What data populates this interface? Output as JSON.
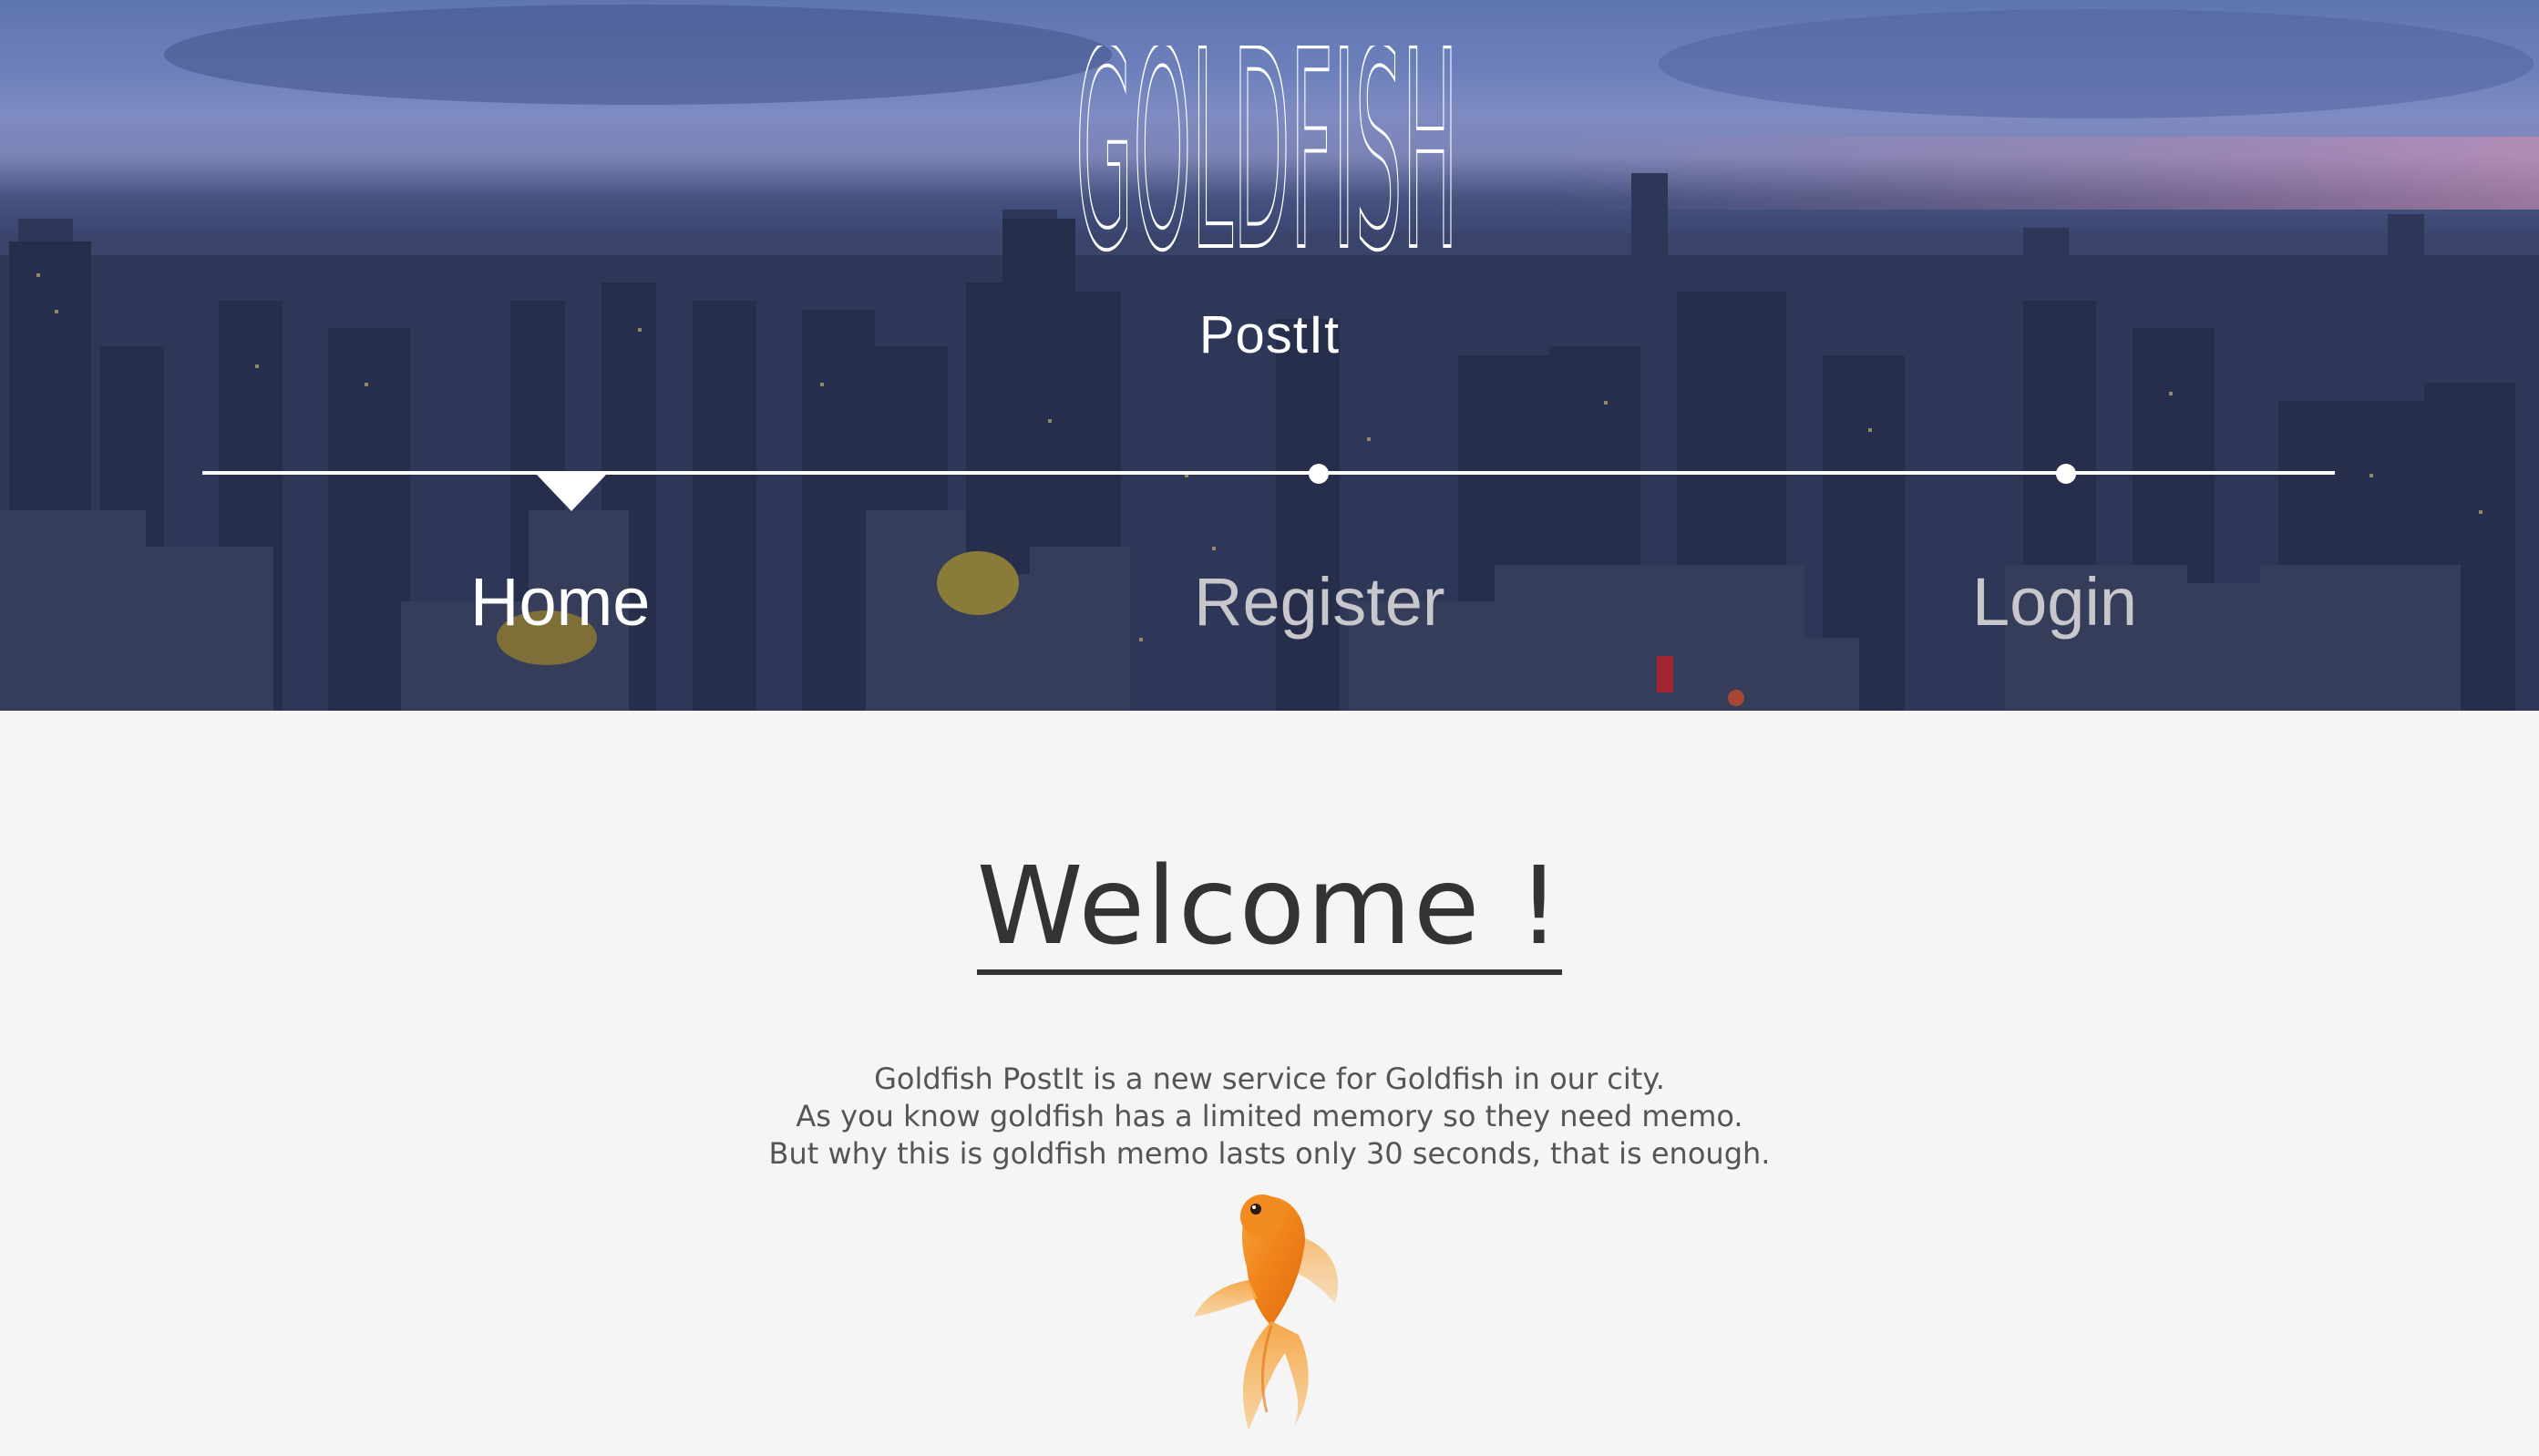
{
  "header": {
    "logo_text": "GOLDFISH",
    "subtitle": "PostIt"
  },
  "nav": {
    "items": [
      {
        "label": "Home",
        "active": true
      },
      {
        "label": "Register",
        "active": false
      },
      {
        "label": "Login",
        "active": false
      }
    ]
  },
  "main": {
    "heading": "Welcome !",
    "paragraph_lines": [
      "Goldfish PostIt is a new service for Goldfish in our city.",
      "As you know goldfish has a limited memory so they need memo.",
      "But why this is goldfish memo lasts only 30 seconds, that is enough."
    ],
    "image": "goldfish-illustration"
  },
  "colors": {
    "page_background": "#f5f5f5",
    "hero_overlay": "#2a3049",
    "nav_active": "#ffffff",
    "nav_inactive": "#c8c8cc",
    "heading": "#333333",
    "body_text": "#555555",
    "fish_orange": "#f08a1c"
  }
}
